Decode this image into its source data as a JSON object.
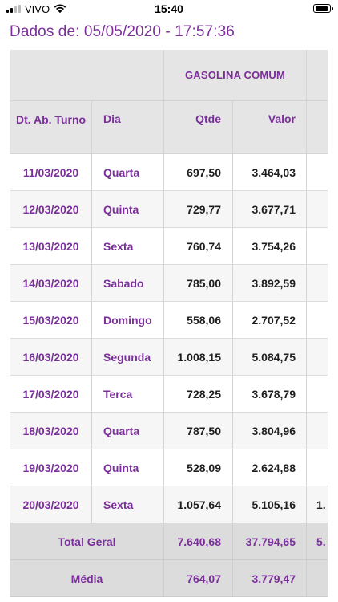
{
  "status_bar": {
    "carrier": "VIVO",
    "time": "15:40",
    "battery_level": 0.9
  },
  "page": {
    "title": "Dados de: 05/05/2020 - 17:57:36"
  },
  "table": {
    "group_header": "GASOLINA COMUM",
    "columns": {
      "date": "Dt. Ab. Turno",
      "day": "Dia",
      "qtde": "Qtde",
      "valor": "Valor"
    },
    "rows": [
      {
        "date": "11/03/2020",
        "day": "Quarta",
        "qtde": "697,50",
        "valor": "3.464,03",
        "next": ""
      },
      {
        "date": "12/03/2020",
        "day": "Quinta",
        "qtde": "729,77",
        "valor": "3.677,71",
        "next": ""
      },
      {
        "date": "13/03/2020",
        "day": "Sexta",
        "qtde": "760,74",
        "valor": "3.754,26",
        "next": ""
      },
      {
        "date": "14/03/2020",
        "day": "Sabado",
        "qtde": "785,00",
        "valor": "3.892,59",
        "next": ""
      },
      {
        "date": "15/03/2020",
        "day": "Domingo",
        "qtde": "558,06",
        "valor": "2.707,52",
        "next": ""
      },
      {
        "date": "16/03/2020",
        "day": "Segunda",
        "qtde": "1.008,15",
        "valor": "5.084,75",
        "next": ""
      },
      {
        "date": "17/03/2020",
        "day": "Terca",
        "qtde": "728,25",
        "valor": "3.678,79",
        "next": ""
      },
      {
        "date": "18/03/2020",
        "day": "Quarta",
        "qtde": "787,50",
        "valor": "3.804,96",
        "next": ""
      },
      {
        "date": "19/03/2020",
        "day": "Quinta",
        "qtde": "528,09",
        "valor": "2.624,88",
        "next": ""
      },
      {
        "date": "20/03/2020",
        "day": "Sexta",
        "qtde": "1.057,64",
        "valor": "5.105,16",
        "next": "1."
      }
    ],
    "total": {
      "label": "Total Geral",
      "qtde": "7.640,68",
      "valor": "37.794,65",
      "next": "5."
    },
    "average": {
      "label": "Média",
      "qtde": "764,07",
      "valor": "3.779,47",
      "next": ""
    }
  },
  "colors": {
    "accent": "#7b2f9a",
    "header_bg": "#e5e5e5",
    "total_bg": "#dcdcdc",
    "row_alt": "#f6f6f6"
  }
}
